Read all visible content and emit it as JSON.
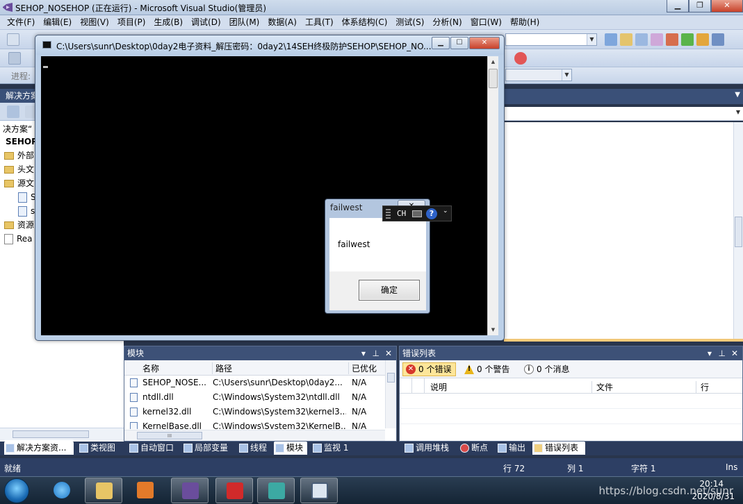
{
  "vs": {
    "title": "SEHOP_NOSEHOP (正在运行) - Microsoft Visual Studio(管理员)",
    "window_buttons": {
      "minimize": "▁",
      "restore": "❐",
      "close": "✕"
    },
    "menu": [
      "文件(F)",
      "编辑(E)",
      "视图(V)",
      "项目(P)",
      "生成(B)",
      "调试(D)",
      "团队(M)",
      "数据(A)",
      "工具(T)",
      "体系结构(C)",
      "测试(S)",
      "分析(N)",
      "窗口(W)",
      "帮助(H)"
    ],
    "process_label": "进程:"
  },
  "solution_explorer": {
    "header": "解决方案",
    "items": [
      {
        "label": "决方案“",
        "kind": "text"
      },
      {
        "label": "SEHOP",
        "kind": "bold"
      },
      {
        "label": "外部",
        "kind": "folder"
      },
      {
        "label": "头文",
        "kind": "folder"
      },
      {
        "label": "源文",
        "kind": "folder"
      },
      {
        "label": "S",
        "kind": "file"
      },
      {
        "label": "s",
        "kind": "file"
      },
      {
        "label": "资源",
        "kind": "folder"
      },
      {
        "label": "Rea",
        "kind": "doc"
      }
    ]
  },
  "console": {
    "title": "C:\\Users\\sunr\\Desktop\\0day2电子资料_解压密码：0day2\\14SEH终极防护SEHOP\\SEHOP_NO...",
    "buttons": {
      "minimize": "▁",
      "maximize": "☐",
      "close": "✕"
    }
  },
  "msgbox": {
    "title": "failwest",
    "message": "failwest",
    "ok_label": "确定",
    "close": "✕"
  },
  "ime": {
    "lang": "CH",
    "help": "?"
  },
  "modules_panel": {
    "title": "模块",
    "columns": [
      "名称",
      "路径",
      "已优化"
    ],
    "rows": [
      {
        "name": "SEHOP_NOSE...",
        "path": "C:\\Users\\sunr\\Desktop\\0day2...",
        "optimized": "N/A"
      },
      {
        "name": "ntdll.dll",
        "path": "C:\\Windows\\System32\\ntdll.dll",
        "optimized": "N/A"
      },
      {
        "name": "kernel32.dll",
        "path": "C:\\Windows\\System32\\kernel3...",
        "optimized": "N/A"
      },
      {
        "name": "KernelBase.dll",
        "path": "C:\\Windows\\System32\\KernelB...",
        "optimized": "N/A"
      }
    ],
    "hscroll_grip": "III"
  },
  "errors_panel": {
    "title": "错误列表",
    "filters": {
      "errors": "0 个错误",
      "warnings": "0 个警告",
      "messages": "0 个消息"
    },
    "columns": [
      "说明",
      "文件",
      "行"
    ]
  },
  "bottom_tabs": {
    "left": [
      "解决方案资...",
      "类视图",
      "自动窗口",
      "局部变量",
      "线程",
      "模块",
      "监视 1"
    ],
    "right": [
      "调用堆栈",
      "断点",
      "输出",
      "错误列表"
    ]
  },
  "status": {
    "ready": "就绪",
    "line": "行 72",
    "col": "列 1",
    "char": "字符 1",
    "ins": "Ins"
  },
  "taskbar": {
    "time": "20:14",
    "date": "2020/8/31",
    "watermark": "https://blog.csdn.net/sunr"
  },
  "colors": {
    "vs_blue": "#3a5078",
    "statusbar": "#2d3f64",
    "console_bg": "#000000",
    "error_filter_active": "#fde69a"
  }
}
